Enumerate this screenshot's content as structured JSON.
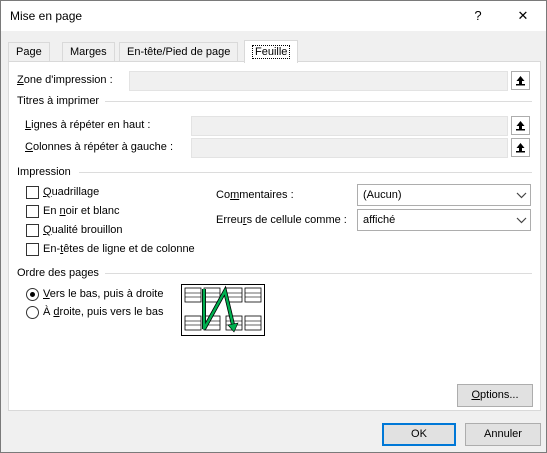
{
  "window": {
    "title": "Mise en page",
    "help_glyph": "?",
    "close_glyph": "✕"
  },
  "tabs": [
    {
      "label": "Page"
    },
    {
      "label": "Marges"
    },
    {
      "label": "En-tête/Pied de page"
    },
    {
      "label": "Feuille"
    }
  ],
  "print_area": {
    "label_u": "Z",
    "label_rest": "one d'impression :",
    "value": ""
  },
  "print_titles": {
    "heading": "Titres à imprimer",
    "rows_top": {
      "label_u": "L",
      "label_rest": "ignes à répéter en haut :",
      "value": ""
    },
    "cols_left": {
      "label_u": "C",
      "label_rest": "olonnes à répéter à gauche :",
      "value": ""
    }
  },
  "print": {
    "heading": "Impression",
    "gridlines": {
      "label_u": "Q",
      "label_rest": "uadrillage",
      "checked": false
    },
    "black_white": {
      "label_pre": "En ",
      "label_u": "n",
      "label_rest": "oir et blanc",
      "checked": false
    },
    "draft": {
      "label_u": "Q",
      "label_rest": "ualité brouillon",
      "checked": false
    },
    "headings": {
      "label_pre": "En-",
      "label_u": "t",
      "label_rest": "êtes de ligne et de colonne",
      "checked": false
    },
    "comments": {
      "label_pre": "Co",
      "label_u": "m",
      "label_rest": "mentaires :",
      "value": "(Aucun)"
    },
    "errors": {
      "label_pre": "Erreu",
      "label_u": "r",
      "label_rest": "s de cellule comme :",
      "value": "affiché"
    }
  },
  "page_order": {
    "heading": "Ordre des pages",
    "down_then_over": {
      "label_u": "V",
      "label_rest": "ers le bas, puis à droite",
      "selected": true
    },
    "over_then_down": {
      "label_pre": "À ",
      "label_u": "d",
      "label_rest": "roite, puis vers le bas",
      "selected": false
    }
  },
  "buttons": {
    "options_u": "O",
    "options_rest": "ptions...",
    "ok": "OK",
    "cancel": "Annuler"
  },
  "colors": {
    "accent": "#0078d7",
    "arrow": "#00b050"
  }
}
